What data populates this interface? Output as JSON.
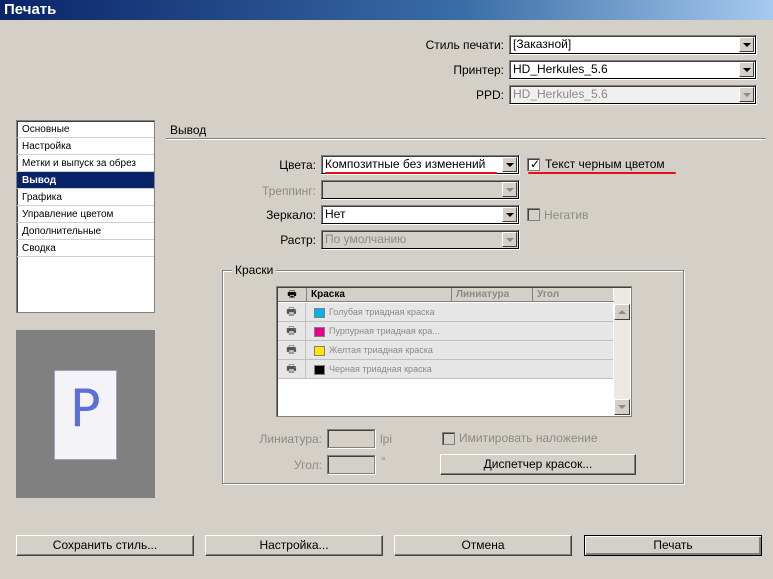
{
  "window": {
    "title": "Печать"
  },
  "top": {
    "style_label": "Стиль печати:",
    "style_value": "[Заказной]",
    "printer_label": "Принтер:",
    "printer_value": "HD_Herkules_5.6",
    "ppd_label": "PPD:",
    "ppd_value": "HD_Herkules_5.6"
  },
  "sidebar": {
    "items": [
      {
        "label": "Основные",
        "selected": false
      },
      {
        "label": "Настройка",
        "selected": false
      },
      {
        "label": "Метки и выпуск за обрез",
        "selected": false
      },
      {
        "label": "Вывод",
        "selected": true
      },
      {
        "label": "Графика",
        "selected": false
      },
      {
        "label": "Управление цветом",
        "selected": false
      },
      {
        "label": "Дополнительные",
        "selected": false
      },
      {
        "label": "Сводка",
        "selected": false
      }
    ]
  },
  "preview": {
    "glyph": "P"
  },
  "output": {
    "section_title": "Вывод",
    "colors_label": "Цвета:",
    "colors_value": "Композитные без изменений",
    "black_text_label": "Текст черным цветом",
    "black_text_checked": true,
    "trapping_label": "Треппинг:",
    "trapping_value": "",
    "mirror_label": "Зеркало:",
    "mirror_value": "Нет",
    "negative_label": "Негатив",
    "negative_checked": false,
    "screen_label": "Растр:",
    "screen_value": "По умолчанию"
  },
  "inks": {
    "group_title": "Краски",
    "columns": [
      "Краска",
      "Линиатура",
      "Угол"
    ],
    "rows": [
      {
        "name": "Голубая триадная краска",
        "color": "#00b4e6"
      },
      {
        "name": "Пурпурная триадная кра...",
        "color": "#e6008c"
      },
      {
        "name": "Желтая триадная краска",
        "color": "#ffe600"
      },
      {
        "name": "Черная триадная краска",
        "color": "#000000"
      }
    ],
    "frequency_label": "Линиатура:",
    "frequency_unit": "lpi",
    "angle_label": "Угол:",
    "angle_unit": "°",
    "simulate_overprint_label": "Имитировать наложение",
    "ink_manager_button": "Диспетчер красок..."
  },
  "buttons": {
    "save_style": "Сохранить стиль...",
    "setup": "Настройка...",
    "cancel": "Отмена",
    "print": "Печать"
  },
  "accent_colors": {
    "selection": "#0a246a",
    "annotation": "#e3101a",
    "title_bar": "#0a246a"
  }
}
